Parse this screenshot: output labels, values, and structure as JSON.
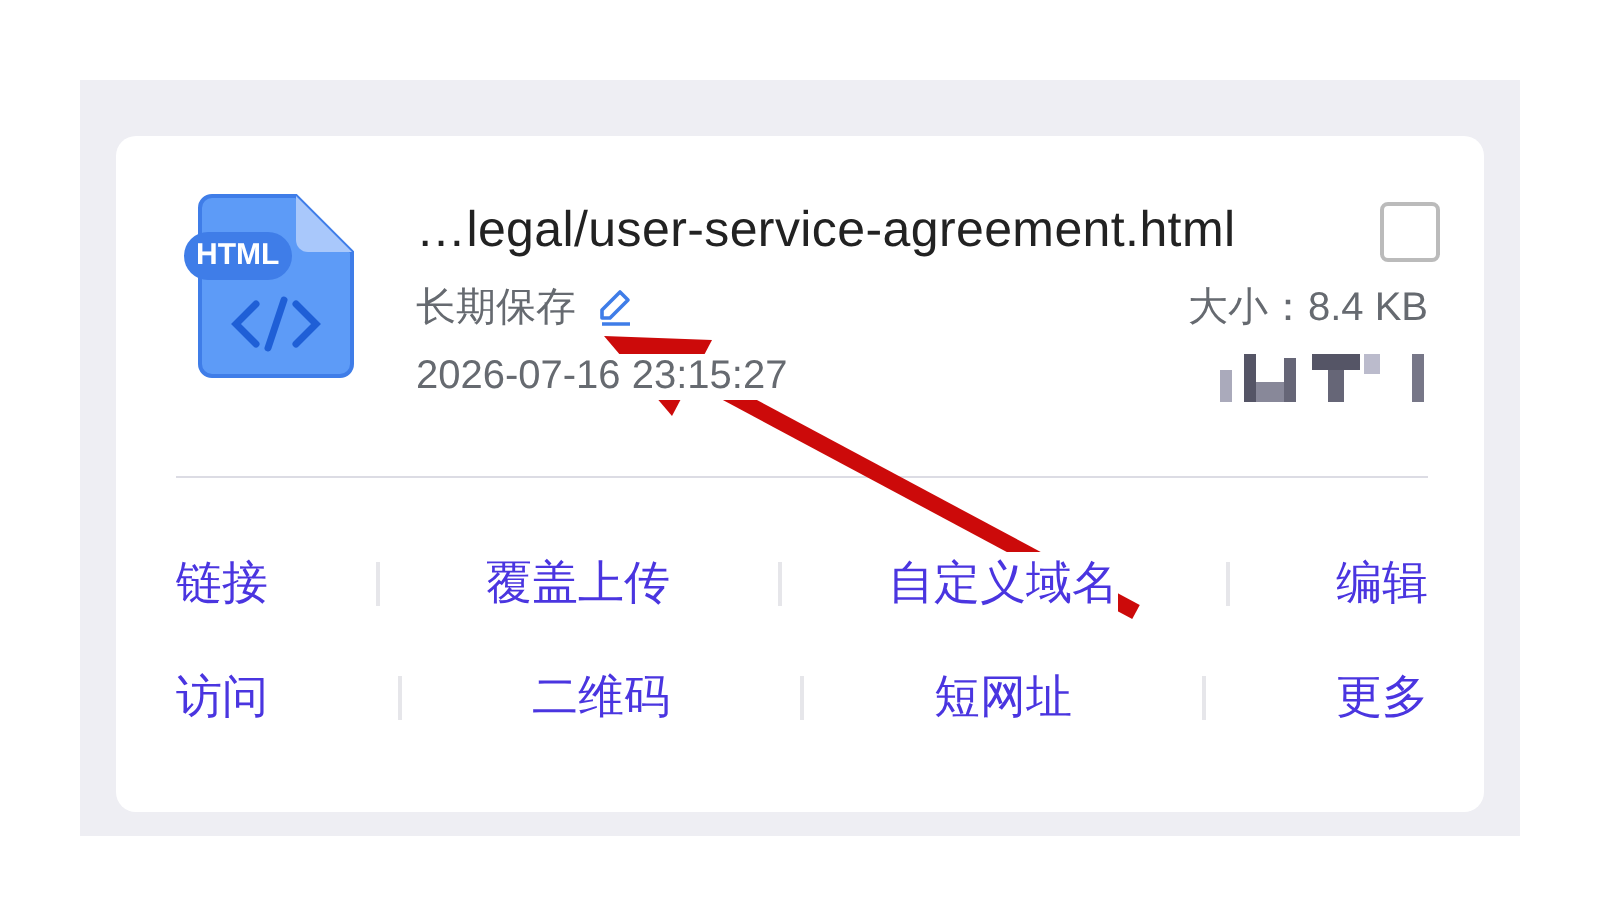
{
  "file": {
    "type_badge": "HTML",
    "name": "…legal/user-service-agreement.html",
    "storage": "长期保存",
    "size": "大小：8.4 KB",
    "date": "2026-07-16 23:15:27"
  },
  "actions": [
    [
      "链接",
      "覆盖上传",
      "自定义域名",
      "编辑"
    ],
    [
      "访问",
      "二维码",
      "短网址",
      "更多"
    ]
  ]
}
